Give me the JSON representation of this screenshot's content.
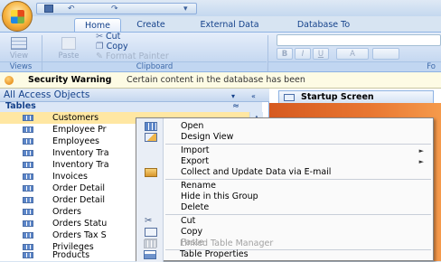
{
  "quick_access": {
    "undo": "↶",
    "redo": "↷",
    "more": "▾"
  },
  "tabs": [
    {
      "label": "Home",
      "active": true
    },
    {
      "label": "Create",
      "active": false
    },
    {
      "label": "External Data",
      "active": false
    },
    {
      "label": "Database To",
      "active": false
    }
  ],
  "ribbon": {
    "view_label": "View",
    "paste_label": "Paste",
    "cut_label": "Cut",
    "copy_label": "Copy",
    "format_painter_label": "Format Painter",
    "groups": {
      "views": "Views",
      "clipboard": "Clipboard",
      "font": "Fo"
    },
    "font_buttons": {
      "bold": "B",
      "italic": "I",
      "underline": "U",
      "font_color": "A"
    }
  },
  "security_bar": {
    "title": "Security Warning",
    "message": "Certain content in the database has been"
  },
  "nav_pane": {
    "header": "All Access Objects",
    "dropdown_glyph": "▾",
    "collapse_glyph": "«",
    "group": "Tables",
    "group_toggle": "≈",
    "items": [
      {
        "label": "Customers",
        "selected": true
      },
      {
        "label": "Employee Pr",
        "selected": false
      },
      {
        "label": "Employees",
        "selected": false
      },
      {
        "label": "Inventory Tra",
        "selected": false
      },
      {
        "label": "Inventory Tra",
        "selected": false
      },
      {
        "label": "Invoices",
        "selected": false
      },
      {
        "label": "Order Detail",
        "selected": false
      },
      {
        "label": "Order Detail",
        "selected": false
      },
      {
        "label": "Orders",
        "selected": false
      },
      {
        "label": "Orders Statu",
        "selected": false
      },
      {
        "label": "Orders Tax S",
        "selected": false
      },
      {
        "label": "Privileges",
        "selected": false
      },
      {
        "label": "Products",
        "selected": false
      }
    ]
  },
  "document": {
    "tab_label": "Startup Screen"
  },
  "context_menu": {
    "items": [
      {
        "label": "Open",
        "icon": "open-table-icon",
        "enabled": true,
        "submenu": false
      },
      {
        "label": "Design View",
        "icon": "design-view-icon",
        "enabled": true,
        "submenu": false
      },
      {
        "label": "Import",
        "icon": "",
        "enabled": true,
        "submenu": true
      },
      {
        "label": "Export",
        "icon": "",
        "enabled": true,
        "submenu": true
      },
      {
        "label": "Collect and Update Data via E-mail",
        "icon": "email-data-icon",
        "enabled": true,
        "submenu": false
      },
      {
        "label": "Rename",
        "icon": "",
        "enabled": true,
        "submenu": false
      },
      {
        "label": "Hide in this Group",
        "icon": "",
        "enabled": true,
        "submenu": false
      },
      {
        "label": "Delete",
        "icon": "",
        "enabled": true,
        "submenu": false
      },
      {
        "label": "Cut",
        "icon": "scissors-icon",
        "enabled": true,
        "submenu": false
      },
      {
        "label": "Copy",
        "icon": "copy-icon",
        "enabled": true,
        "submenu": false
      },
      {
        "label": "Paste",
        "icon": "paste-icon",
        "enabled": false,
        "submenu": false
      },
      {
        "label": "Linked Table Manager",
        "icon": "linked-table-icon",
        "enabled": false,
        "submenu": false
      },
      {
        "label": "Table Properties",
        "icon": "table-properties-icon",
        "enabled": true,
        "submenu": false
      }
    ]
  }
}
